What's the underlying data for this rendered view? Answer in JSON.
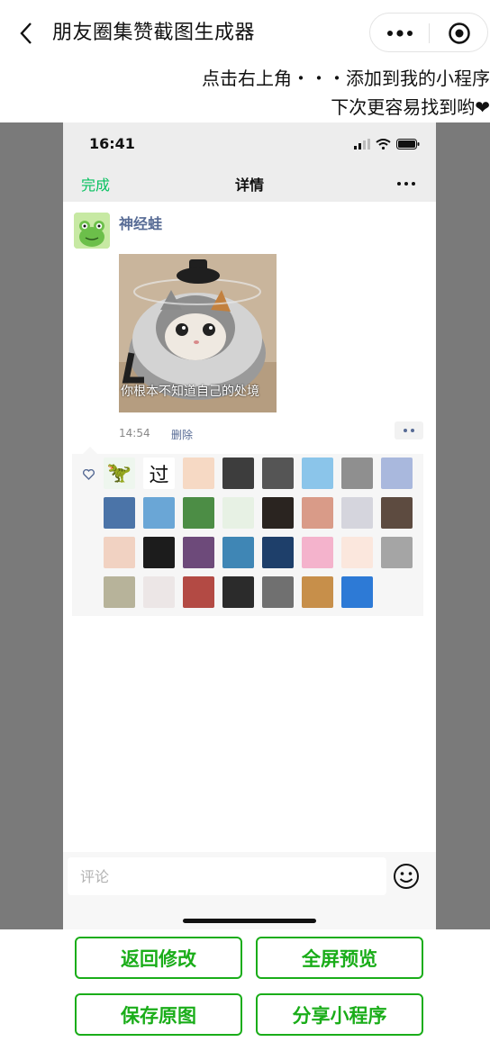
{
  "app": {
    "title": "朋友圈集赞截图生成器",
    "tip_line1": "点击右上角・・・添加到我的小程序",
    "tip_line2": "下次更容易找到哟❤"
  },
  "phone": {
    "status_time": "16:41",
    "nav": {
      "done_label": "完成",
      "title": "详情"
    },
    "post": {
      "username": "神经蛙",
      "photo_caption": "你根本不知道自己的处境",
      "time": "14:54",
      "delete_label": "删除"
    },
    "likes": {
      "avatars": [
        {
          "name": "avatar-dino",
          "color": "#eef6ee",
          "text": "🦖"
        },
        {
          "name": "avatar-guo-text",
          "color": "#ffffff",
          "text": "过"
        },
        {
          "name": "avatar-cartoon-girl",
          "color": "#f6d9c4",
          "text": ""
        },
        {
          "name": "avatar-dark-landscape",
          "color": "#3d3d3d",
          "text": ""
        },
        {
          "name": "avatar-dark-figure",
          "color": "#555555",
          "text": ""
        },
        {
          "name": "avatar-crayon",
          "color": "#8bc5ea",
          "text": ""
        },
        {
          "name": "avatar-forest",
          "color": "#8f8f8f",
          "text": ""
        },
        {
          "name": "avatar-anime",
          "color": "#a9b8dd",
          "text": ""
        },
        {
          "name": "avatar-blue-card",
          "color": "#4b74a8",
          "text": ""
        },
        {
          "name": "avatar-sky-photo",
          "color": "#6aa6d6",
          "text": ""
        },
        {
          "name": "avatar-green",
          "color": "#4c8d45",
          "text": ""
        },
        {
          "name": "avatar-green-text",
          "color": "#e7f1e4",
          "text": ""
        },
        {
          "name": "avatar-portrait-dark",
          "color": "#2a2420",
          "text": ""
        },
        {
          "name": "avatar-girl-photo",
          "color": "#d99b88",
          "text": ""
        },
        {
          "name": "avatar-cat-ears",
          "color": "#d5d5dd",
          "text": ""
        },
        {
          "name": "avatar-man-glasses",
          "color": "#5d4b40",
          "text": ""
        },
        {
          "name": "avatar-baby",
          "color": "#f1d2c2",
          "text": ""
        },
        {
          "name": "avatar-campfire",
          "color": "#1c1c1c",
          "text": ""
        },
        {
          "name": "avatar-tom-cat",
          "color": "#6d4a7a",
          "text": ""
        },
        {
          "name": "avatar-blue-girl",
          "color": "#3f86b5",
          "text": ""
        },
        {
          "name": "avatar-anime-boy",
          "color": "#1e3f6a",
          "text": ""
        },
        {
          "name": "avatar-pink-anime",
          "color": "#f4b3cc",
          "text": ""
        },
        {
          "name": "avatar-hand",
          "color": "#fbe7dd",
          "text": ""
        },
        {
          "name": "avatar-building",
          "color": "#a5a5a5",
          "text": ""
        },
        {
          "name": "avatar-room",
          "color": "#b7b39a",
          "text": ""
        },
        {
          "name": "avatar-red-hat",
          "color": "#ece6e6",
          "text": ""
        },
        {
          "name": "avatar-red-wall",
          "color": "#b34a44",
          "text": ""
        },
        {
          "name": "avatar-curly-hair",
          "color": "#2b2b2b",
          "text": ""
        },
        {
          "name": "avatar-bw-group",
          "color": "#707070",
          "text": ""
        },
        {
          "name": "avatar-anime-pair",
          "color": "#c78f4a",
          "text": ""
        },
        {
          "name": "avatar-blue-sky",
          "color": "#2d7ad6",
          "text": ""
        }
      ]
    },
    "comment_placeholder": "评论"
  },
  "actions": {
    "back_edit": "返回修改",
    "fullscreen": "全屏预览",
    "save": "保存原图",
    "share": "分享小程序"
  },
  "colors": {
    "wechat_green": "#07c160",
    "button_green": "#1aad19",
    "link_blue": "#576b95",
    "backdrop_grey": "#7a7a7a"
  }
}
